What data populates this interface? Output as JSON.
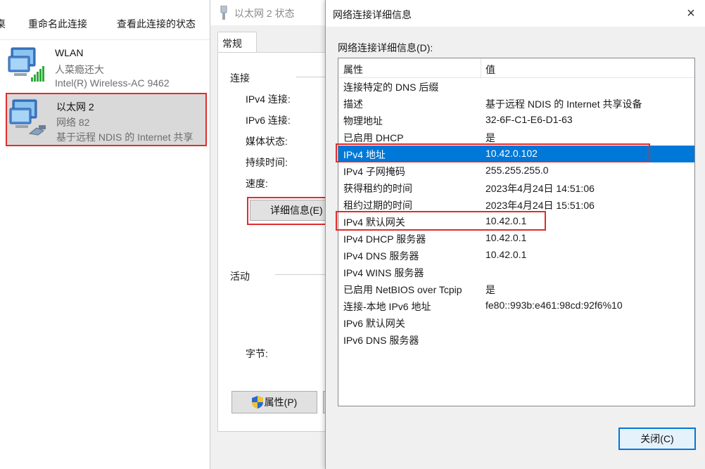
{
  "explorer": {
    "commands": [
      "桌",
      "重命名此连接",
      "查看此连接的状态"
    ],
    "connections": [
      {
        "name": "WLAN",
        "line1": "人菜瘾还大",
        "line2": "Intel(R) Wireless-AC 9462",
        "icon": "wifi-adapter-icon"
      },
      {
        "name": "以太网 2",
        "line1": "网络 82",
        "line2": "基于远程 NDIS 的 Internet 共享",
        "icon": "ethernet-adapter-icon",
        "selected": true
      }
    ]
  },
  "status_dialog": {
    "title": "以太网 2 状态",
    "tab": "常规",
    "connection_group": "连接",
    "fields": [
      "IPv4 连接:",
      "IPv6 连接:",
      "媒体状态:",
      "持续时间:",
      "速度:"
    ],
    "details_button": "详细信息(E)",
    "activity_group": "活动",
    "bytes_label": "字节:",
    "properties_button": "属性(P)"
  },
  "details_dialog": {
    "title": "网络连接详细信息",
    "close_icon": "×",
    "list_label": "网络连接详细信息(D):",
    "columns": {
      "property": "属性",
      "value": "值"
    },
    "rows": [
      {
        "property": "连接特定的 DNS 后缀",
        "value": ""
      },
      {
        "property": "描述",
        "value": "基于远程 NDIS 的 Internet 共享设备"
      },
      {
        "property": "物理地址",
        "value": "32-6F-C1-E6-D1-63"
      },
      {
        "property": "已启用 DHCP",
        "value": "是"
      },
      {
        "property": "IPv4 地址",
        "value": "10.42.0.102"
      },
      {
        "property": "IPv4 子网掩码",
        "value": "255.255.255.0"
      },
      {
        "property": "获得租约的时间",
        "value": "2023年4月24日 14:51:06"
      },
      {
        "property": "租约过期的时间",
        "value": "2023年4月24日 15:51:06"
      },
      {
        "property": "IPv4 默认网关",
        "value": "10.42.0.1"
      },
      {
        "property": "IPv4 DHCP 服务器",
        "value": "10.42.0.1"
      },
      {
        "property": "IPv4 DNS 服务器",
        "value": "10.42.0.1"
      },
      {
        "property": "IPv4 WINS 服务器",
        "value": ""
      },
      {
        "property": "已启用 NetBIOS over Tcpip",
        "value": "是"
      },
      {
        "property": "连接-本地 IPv6 地址",
        "value": "fe80::993b:e461:98cd:92f6%10"
      },
      {
        "property": "IPv6 默认网关",
        "value": ""
      },
      {
        "property": "IPv6 DNS 服务器",
        "value": ""
      }
    ],
    "selected_row": 4,
    "close_button": "关闭(C)"
  },
  "colors": {
    "highlight": "#e02c2c",
    "selection": "#0078d7"
  }
}
